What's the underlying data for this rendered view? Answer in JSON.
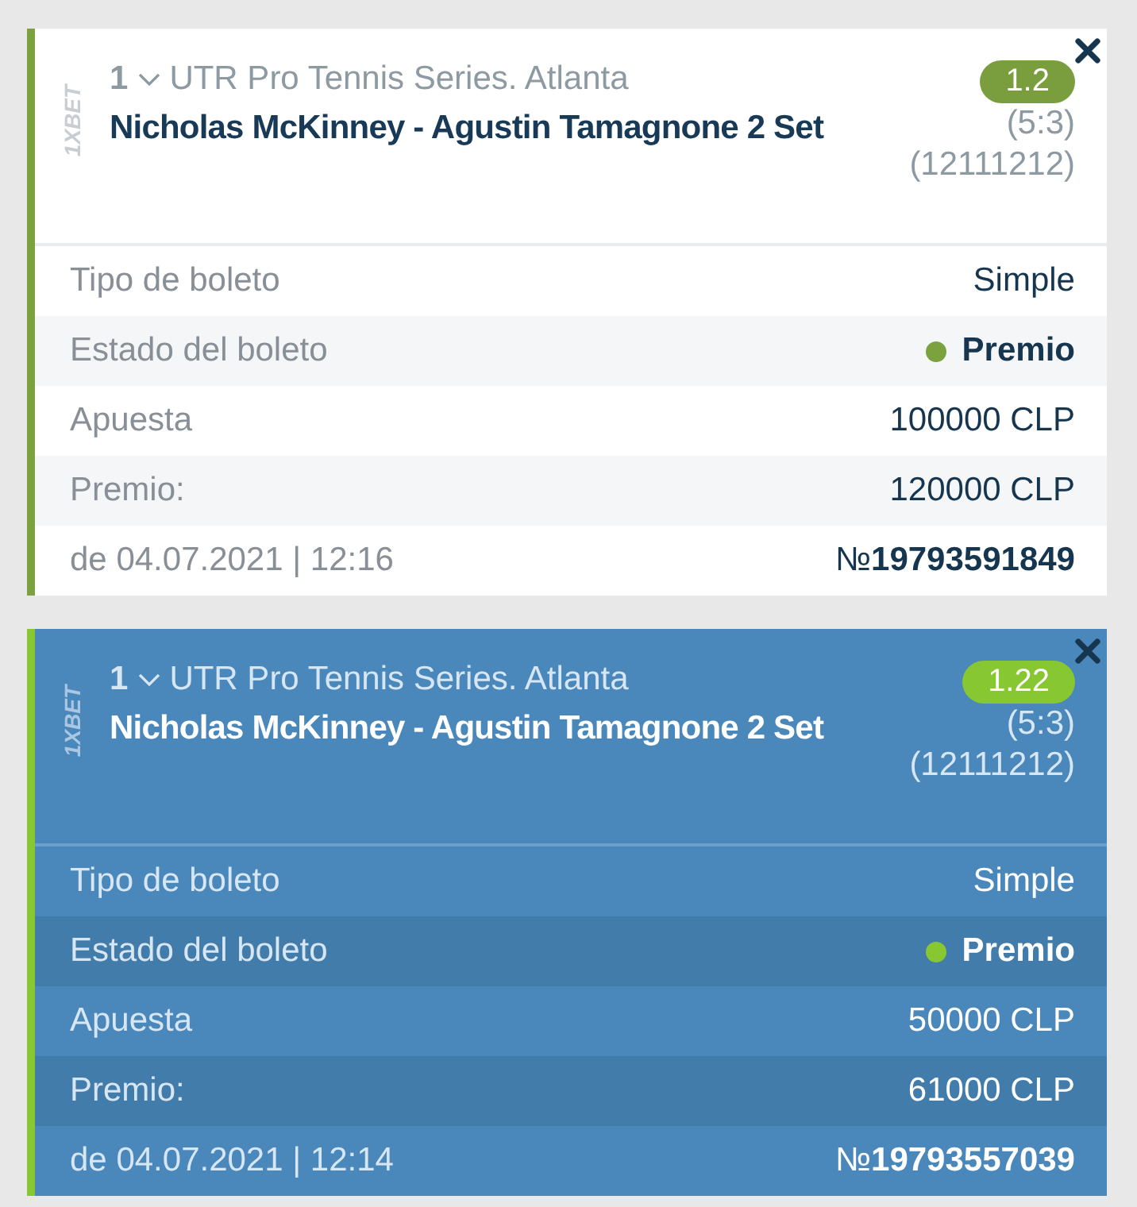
{
  "tickets": [
    {
      "selected": false,
      "logo": "1XBET",
      "count": "1",
      "league": "UTR Pro Tennis Series. Atlanta",
      "match": "Nicholas McKinney - Agustin Tamagnone 2 Set",
      "odds": "1.2",
      "score": "(5:3)",
      "points": "(12111212)",
      "rows": [
        {
          "kind": "plain",
          "label": "Tipo de boleto",
          "value": "Simple"
        },
        {
          "kind": "status",
          "label": "Estado del boleto",
          "value": "Premio"
        },
        {
          "kind": "plain",
          "label": "Apuesta",
          "value": "100000 CLP"
        },
        {
          "kind": "plain",
          "label": "Premio:",
          "value": "120000 CLP"
        },
        {
          "kind": "footer",
          "label": "de 04.07.2021 | 12:16",
          "value": "№**19793591849**"
        }
      ]
    },
    {
      "selected": true,
      "logo": "1XBET",
      "count": "1",
      "league": "UTR Pro Tennis Series. Atlanta",
      "match": "Nicholas McKinney - Agustin Tamagnone 2 Set",
      "odds": "1.22",
      "score": "(5:3)",
      "points": "(12111212)",
      "rows": [
        {
          "kind": "plain",
          "label": "Tipo de boleto",
          "value": "Simple"
        },
        {
          "kind": "status",
          "label": "Estado del boleto",
          "value": "Premio"
        },
        {
          "kind": "plain",
          "label": "Apuesta",
          "value": "50000 CLP"
        },
        {
          "kind": "plain",
          "label": "Premio:",
          "value": "61000 CLP"
        },
        {
          "kind": "footer",
          "label": "de 04.07.2021 | 12:14",
          "value": "№**19793557039**"
        }
      ]
    }
  ]
}
